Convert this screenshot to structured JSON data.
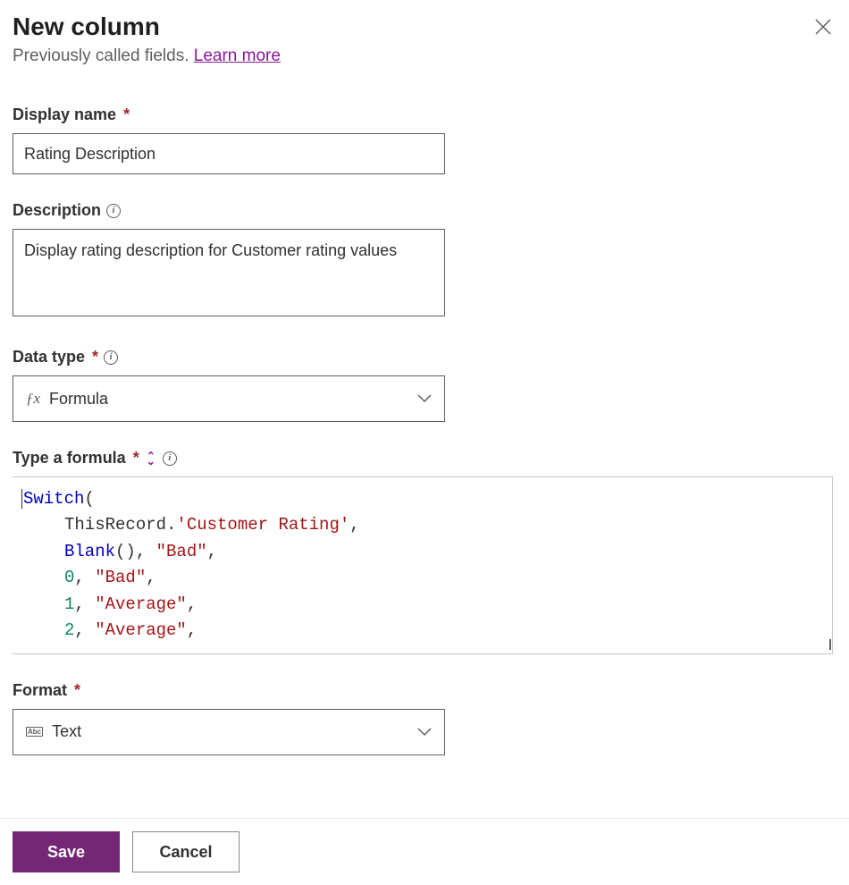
{
  "header": {
    "title": "New column",
    "subtitle_text": "Previously called fields.",
    "learn_more": "Learn more"
  },
  "fields": {
    "display_name": {
      "label": "Display name",
      "value": "Rating Description"
    },
    "description": {
      "label": "Description",
      "value": "Display rating description for Customer rating values"
    },
    "data_type": {
      "label": "Data type",
      "value": "Formula"
    },
    "formula": {
      "label": "Type a formula"
    },
    "format": {
      "label": "Format",
      "value": "Text"
    }
  },
  "formula_tokens": [
    {
      "line": 0,
      "cls": "tok-func",
      "text": "Switch"
    },
    {
      "line": 0,
      "cls": "tok-plain",
      "text": "("
    },
    {
      "line": 1,
      "cls": "indent",
      "text": ""
    },
    {
      "line": 1,
      "cls": "tok-plain",
      "text": "ThisRecord."
    },
    {
      "line": 1,
      "cls": "tok-str",
      "text": "'Customer Rating'"
    },
    {
      "line": 1,
      "cls": "tok-plain",
      "text": ","
    },
    {
      "line": 2,
      "cls": "indent",
      "text": ""
    },
    {
      "line": 2,
      "cls": "tok-func",
      "text": "Blank"
    },
    {
      "line": 2,
      "cls": "tok-plain",
      "text": "(), "
    },
    {
      "line": 2,
      "cls": "tok-str",
      "text": "\"Bad\""
    },
    {
      "line": 2,
      "cls": "tok-plain",
      "text": ","
    },
    {
      "line": 3,
      "cls": "indent",
      "text": ""
    },
    {
      "line": 3,
      "cls": "tok-num",
      "text": "0"
    },
    {
      "line": 3,
      "cls": "tok-plain",
      "text": ", "
    },
    {
      "line": 3,
      "cls": "tok-str",
      "text": "\"Bad\""
    },
    {
      "line": 3,
      "cls": "tok-plain",
      "text": ","
    },
    {
      "line": 4,
      "cls": "indent",
      "text": ""
    },
    {
      "line": 4,
      "cls": "tok-num",
      "text": "1"
    },
    {
      "line": 4,
      "cls": "tok-plain",
      "text": ", "
    },
    {
      "line": 4,
      "cls": "tok-str",
      "text": "\"Average\""
    },
    {
      "line": 4,
      "cls": "tok-plain",
      "text": ","
    },
    {
      "line": 5,
      "cls": "indent",
      "text": ""
    },
    {
      "line": 5,
      "cls": "tok-num",
      "text": "2"
    },
    {
      "line": 5,
      "cls": "tok-plain",
      "text": ", "
    },
    {
      "line": 5,
      "cls": "tok-str",
      "text": "\"Average\""
    },
    {
      "line": 5,
      "cls": "tok-plain",
      "text": ","
    }
  ],
  "buttons": {
    "save": "Save",
    "cancel": "Cancel"
  }
}
